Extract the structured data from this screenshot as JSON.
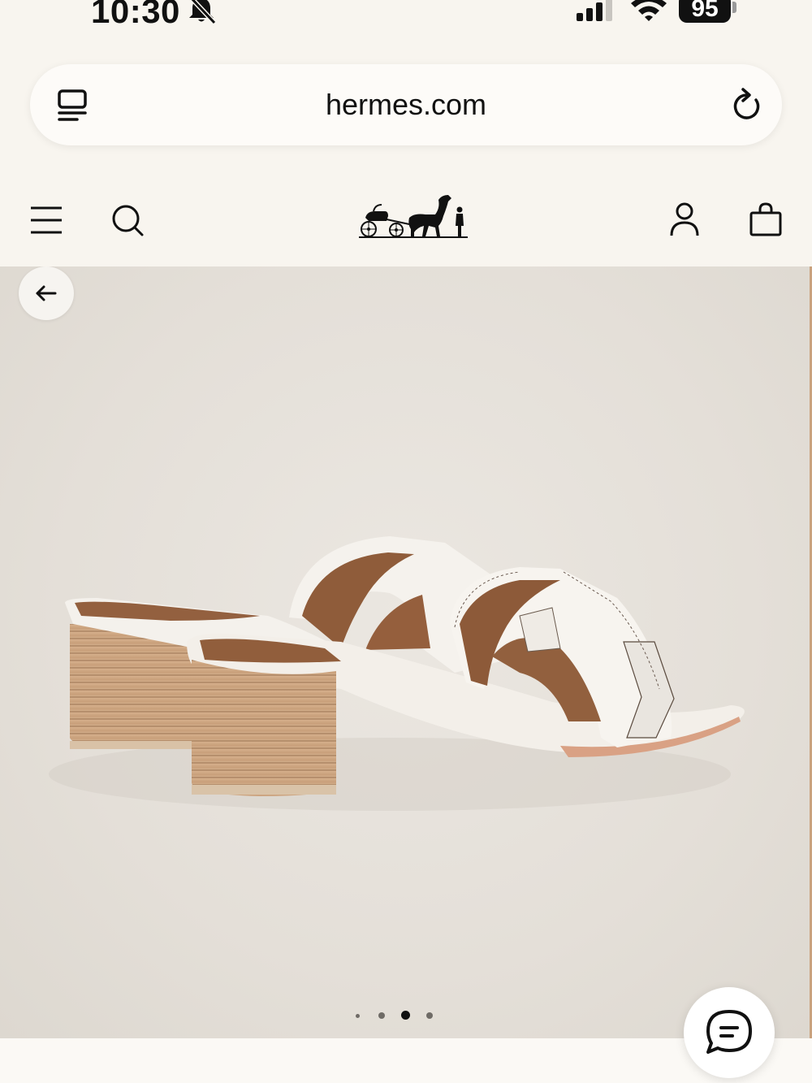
{
  "status_bar": {
    "time": "10:30",
    "battery": "95",
    "icons": [
      "bell-slash-icon",
      "cellular-signal-icon",
      "wifi-icon",
      "battery-icon"
    ]
  },
  "browser": {
    "url": "hermes.com",
    "icons": [
      "reader-mode-icon",
      "reload-icon"
    ]
  },
  "site_header": {
    "icons": [
      "hamburger-menu-icon",
      "search-icon",
      "carriage-logo",
      "account-icon",
      "shopping-bag-icon"
    ]
  },
  "product_gallery": {
    "slide_count": 4,
    "active_slide": 3,
    "back_icon": "arrow-left-icon"
  },
  "chat": {
    "icon": "chat-bubble-icon"
  },
  "colors": {
    "page_background": "#f8f5ef",
    "image_background": "#e7e3dd",
    "leather_white": "#f6f3ee",
    "lining_brown": "#8e5c3c",
    "heel_wood": "#c9a27e"
  }
}
